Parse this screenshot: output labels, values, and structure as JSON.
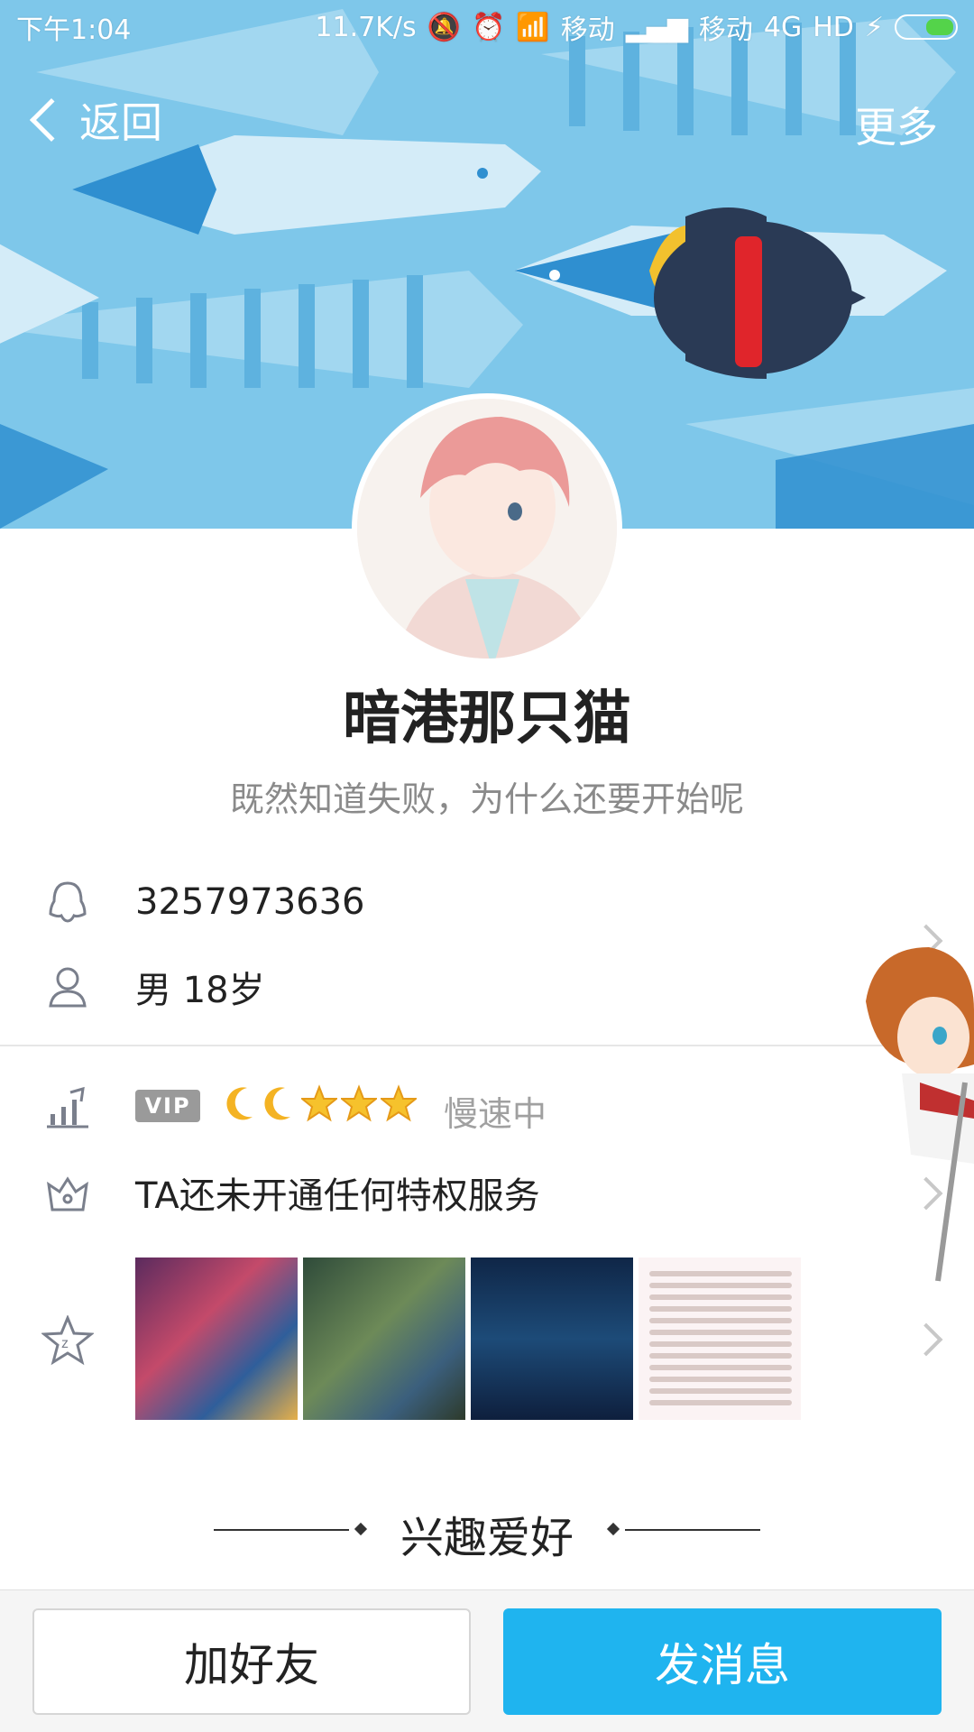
{
  "status_bar": {
    "time": "下午1:04",
    "network_speed": "11.7K/s",
    "carrier1": "移动",
    "carrier2": "移动",
    "network_type": "4G",
    "hd": "HD",
    "icons": [
      "mute-icon",
      "alarm-icon",
      "wifi-icon",
      "signal-icon",
      "signal-icon",
      "charging-icon",
      "battery-icon"
    ]
  },
  "nav": {
    "back_label": "返回",
    "more_label": "更多"
  },
  "profile": {
    "nickname": "暗港那只猫",
    "signature": "既然知道失败，为什么还要开始呢",
    "qq_number": "3257973636",
    "gender_age": "男  18岁"
  },
  "level": {
    "vip_label": "VIP",
    "icons": [
      "moon-icon",
      "moon-icon",
      "star-icon",
      "star-icon",
      "star-icon"
    ],
    "status": "慢速中"
  },
  "privilege": {
    "text": "TA还未开通任何特权服务"
  },
  "photos": {
    "count_visible": 4
  },
  "section": {
    "title": "兴趣爱好"
  },
  "actions": {
    "add_friend": "加好友",
    "send_message": "发消息"
  },
  "colors": {
    "banner": "#7cc6ea",
    "primary_button": "#1fb4ef",
    "penguin_scarf": "#e0252b"
  }
}
